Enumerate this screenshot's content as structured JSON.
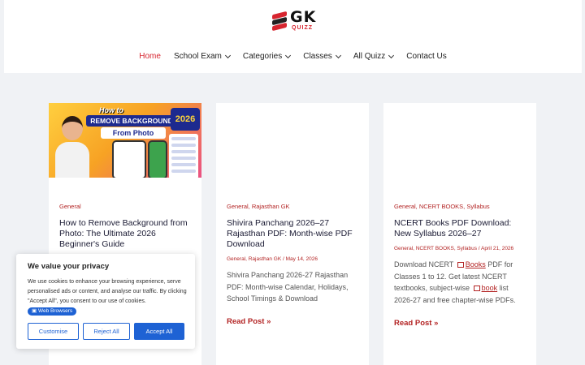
{
  "site": {
    "logo_text": "GK",
    "logo_subtext": "QUIZZ"
  },
  "nav": {
    "items": [
      {
        "label": "Home",
        "active": true,
        "dropdown": false
      },
      {
        "label": "School Exam",
        "active": false,
        "dropdown": true
      },
      {
        "label": "Categories",
        "active": false,
        "dropdown": true
      },
      {
        "label": "Classes",
        "active": false,
        "dropdown": true
      },
      {
        "label": "All Quizz",
        "active": false,
        "dropdown": true
      },
      {
        "label": "Contact Us",
        "active": false,
        "dropdown": false
      }
    ]
  },
  "posts": [
    {
      "thumbnail": {
        "line1": "How to",
        "line2": "REMOVE BACKGROUND",
        "line3": "From Photo",
        "year": "2026"
      },
      "categories": "General",
      "title": "How to Remove Background from Photo: The Ultimate 2026 Beginner's Guide"
    },
    {
      "categories": "General, Rajasthan GK",
      "title": "Shivira Panchang 2026–27 Rajasthan PDF: Month-wise PDF Download",
      "meta": "General, Rajasthan GK / May 14, 2026",
      "excerpt": "Shivira Panchang 2026-27 Rajasthan PDF: Month-wise Calendar, Holidays, School Timings & Download",
      "read_more": "Read Post »"
    },
    {
      "categories": "General, NCERT BOOKS, Syllabus",
      "title": "NCERT Books PDF Download: New Syllabus 2026–27",
      "meta": "General, NCERT BOOKS, Syllabus / April 21, 2026",
      "excerpt_parts": {
        "p1": "Download NCERT",
        "link1": "Books",
        "p2": "PDF for Classes 1 to 12. Get latest NCERT textbooks, subject-wise",
        "link2": "book",
        "p3": "list 2026-27 and free chapter-wise PDFs."
      },
      "read_more": "Read Post »"
    }
  ],
  "cookie_banner": {
    "title": "We value your privacy",
    "text": "We use cookies to enhance your browsing experience, serve personalised ads or content, and analyse our traffic. By clicking \"Accept All\", you consent to our use of cookies.",
    "chip": "Web Browsers",
    "buttons": {
      "customise": "Customise",
      "reject": "Reject All",
      "accept": "Accept All"
    }
  },
  "colors": {
    "accent": "#d7252f",
    "link": "#b32424",
    "button_blue": "#1e62d4"
  }
}
